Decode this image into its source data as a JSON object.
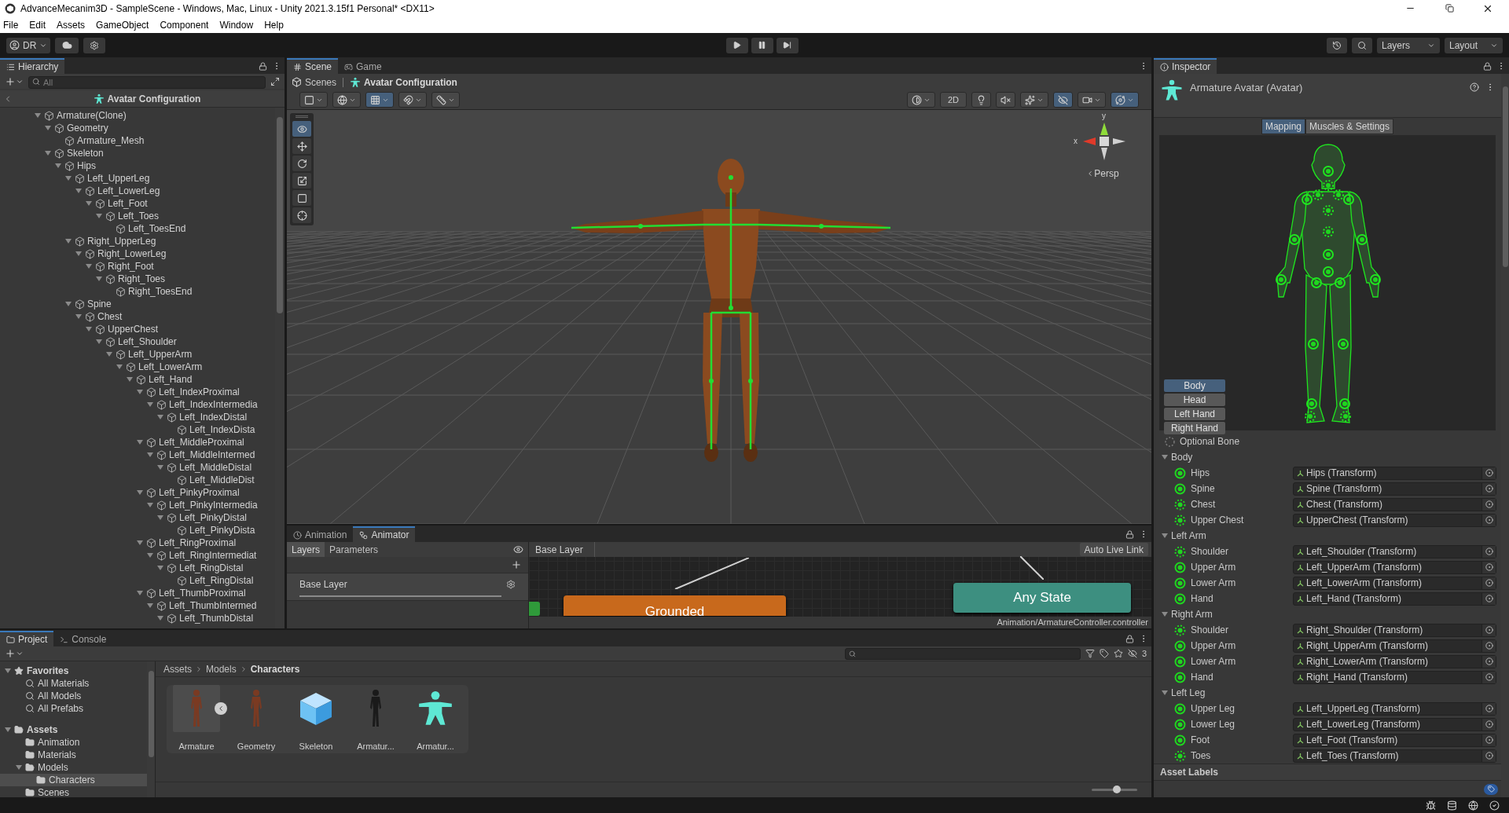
{
  "window": {
    "title": "AdvanceMecanim3D - SampleScene - Windows, Mac, Linux - Unity 2021.3.15f1 Personal* <DX11>"
  },
  "menu": [
    "File",
    "Edit",
    "Assets",
    "GameObject",
    "Component",
    "Window",
    "Help"
  ],
  "toolbar": {
    "account": "DR",
    "layers": "Layers",
    "layout": "Layout"
  },
  "hierarchy": {
    "tabs": [
      {
        "label": "Hierarchy",
        "kind": "hierarchy",
        "selected": true
      }
    ],
    "search": {
      "placeholder": "All"
    },
    "header": "Avatar Configuration",
    "tree": [
      {
        "label": "Armature(Clone)",
        "expanded": true,
        "children": [
          {
            "label": "Geometry",
            "expanded": true,
            "children": [
              {
                "label": "Armature_Mesh"
              }
            ]
          },
          {
            "label": "Skeleton",
            "expanded": true,
            "children": [
              {
                "label": "Hips",
                "expanded": true,
                "children": [
                  {
                    "label": "Left_UpperLeg",
                    "expanded": true,
                    "children": [
                      {
                        "label": "Left_LowerLeg",
                        "expanded": true,
                        "children": [
                          {
                            "label": "Left_Foot",
                            "expanded": true,
                            "children": [
                              {
                                "label": "Left_Toes",
                                "expanded": true,
                                "children": [
                                  {
                                    "label": "Left_ToesEnd"
                                  }
                                ]
                              }
                            ]
                          }
                        ]
                      }
                    ]
                  },
                  {
                    "label": "Right_UpperLeg",
                    "expanded": true,
                    "children": [
                      {
                        "label": "Right_LowerLeg",
                        "expanded": true,
                        "children": [
                          {
                            "label": "Right_Foot",
                            "expanded": true,
                            "children": [
                              {
                                "label": "Right_Toes",
                                "expanded": true,
                                "children": [
                                  {
                                    "label": "Right_ToesEnd"
                                  }
                                ]
                              }
                            ]
                          }
                        ]
                      }
                    ]
                  },
                  {
                    "label": "Spine",
                    "expanded": true,
                    "children": [
                      {
                        "label": "Chest",
                        "expanded": true,
                        "children": [
                          {
                            "label": "UpperChest",
                            "expanded": true,
                            "children": [
                              {
                                "label": "Left_Shoulder",
                                "expanded": true,
                                "children": [
                                  {
                                    "label": "Left_UpperArm",
                                    "expanded": true,
                                    "children": [
                                      {
                                        "label": "Left_LowerArm",
                                        "expanded": true,
                                        "children": [
                                          {
                                            "label": "Left_Hand",
                                            "expanded": true,
                                            "children": [
                                              {
                                                "label": "Left_IndexProximal",
                                                "expanded": true,
                                                "children": [
                                                  {
                                                    "label": "Left_IndexIntermedia",
                                                    "expanded": true,
                                                    "children": [
                                                      {
                                                        "label": "Left_IndexDistal",
                                                        "expanded": true,
                                                        "children": [
                                                          {
                                                            "label": "Left_IndexDista"
                                                          }
                                                        ]
                                                      }
                                                    ]
                                                  }
                                                ]
                                              },
                                              {
                                                "label": "Left_MiddleProximal",
                                                "expanded": true,
                                                "children": [
                                                  {
                                                    "label": "Left_MiddleIntermed",
                                                    "expanded": true,
                                                    "children": [
                                                      {
                                                        "label": "Left_MiddleDistal",
                                                        "expanded": true,
                                                        "children": [
                                                          {
                                                            "label": "Left_MiddleDist"
                                                          }
                                                        ]
                                                      }
                                                    ]
                                                  }
                                                ]
                                              },
                                              {
                                                "label": "Left_PinkyProximal",
                                                "expanded": true,
                                                "children": [
                                                  {
                                                    "label": "Left_PinkyIntermedia",
                                                    "expanded": true,
                                                    "children": [
                                                      {
                                                        "label": "Left_PinkyDistal",
                                                        "expanded": true,
                                                        "children": [
                                                          {
                                                            "label": "Left_PinkyDista"
                                                          }
                                                        ]
                                                      }
                                                    ]
                                                  }
                                                ]
                                              },
                                              {
                                                "label": "Left_RingProximal",
                                                "expanded": true,
                                                "children": [
                                                  {
                                                    "label": "Left_RingIntermediat",
                                                    "expanded": true,
                                                    "children": [
                                                      {
                                                        "label": "Left_RingDistal",
                                                        "expanded": true,
                                                        "children": [
                                                          {
                                                            "label": "Left_RingDistal"
                                                          }
                                                        ]
                                                      }
                                                    ]
                                                  }
                                                ]
                                              },
                                              {
                                                "label": "Left_ThumbProximal",
                                                "expanded": true,
                                                "children": [
                                                  {
                                                    "label": "Left_ThumbIntermed",
                                                    "expanded": true,
                                                    "children": [
                                                      {
                                                        "label": "Left_ThumbDistal",
                                                        "expanded": true
                                                      }
                                                    ]
                                                  }
                                                ]
                                              }
                                            ]
                                          }
                                        ]
                                      }
                                    ]
                                  }
                                ]
                              }
                            ]
                          }
                        ]
                      }
                    ]
                  }
                ]
              }
            ]
          }
        ]
      }
    ]
  },
  "scene": {
    "tabs": [
      {
        "label": "Scene",
        "kind": "scene",
        "selected": true
      },
      {
        "label": "Game",
        "kind": "game",
        "selected": false
      }
    ],
    "breadcrumb": [
      "Scenes",
      "Avatar Configuration"
    ],
    "toolbar_left": [
      {
        "kind": "draw-mode",
        "on": false,
        "dropdown": true
      },
      {
        "kind": "globe",
        "on": false,
        "dropdown": true
      },
      {
        "kind": "grid-snap",
        "on": true,
        "dropdown": true
      },
      {
        "kind": "snap-increment",
        "on": false,
        "dropdown": true
      },
      {
        "kind": "ruler",
        "on": false,
        "dropdown": true
      }
    ],
    "toolbar_right": [
      {
        "kind": "shading",
        "on": false,
        "dropdown": true
      },
      {
        "kind": "text",
        "label": "2D",
        "on": false,
        "dropdown": false
      },
      {
        "kind": "lighting",
        "on": false,
        "dropdown": false
      },
      {
        "kind": "audio",
        "on": false,
        "dropdown": false
      },
      {
        "kind": "effects",
        "on": false,
        "dropdown": true
      },
      {
        "kind": "hidden",
        "on": true,
        "dropdown": false
      },
      {
        "kind": "camera",
        "on": false,
        "dropdown": true
      },
      {
        "kind": "gizmos",
        "on": true,
        "dropdown": true
      }
    ],
    "tools": [
      {
        "kind": "view",
        "selected": true
      },
      {
        "kind": "move",
        "selected": false
      },
      {
        "kind": "rotate",
        "selected": false
      },
      {
        "kind": "scale",
        "selected": false
      },
      {
        "kind": "rect",
        "selected": false
      },
      {
        "kind": "transform",
        "selected": false
      }
    ],
    "gizmo_labels": [
      "y",
      "x"
    ],
    "view_label": "Persp"
  },
  "animator": {
    "tabs": [
      {
        "label": "Animation",
        "kind": "animation",
        "selected": false
      },
      {
        "label": "Animator",
        "kind": "animator",
        "selected": true
      }
    ],
    "side_tabs": [
      {
        "label": "Layers",
        "selected": true
      },
      {
        "label": "Parameters",
        "selected": false
      }
    ],
    "layers": [
      "Base Layer"
    ],
    "breadcrumb": "Base Layer",
    "live_link": "Auto Live Link",
    "states": [
      {
        "label": "Grounded",
        "color": "#c8691c"
      },
      {
        "label": "Any State",
        "color": "#3d8f80"
      }
    ],
    "path": "Animation/ArmatureController.controller"
  },
  "project": {
    "tabs": [
      {
        "label": "Project",
        "kind": "project",
        "selected": true
      },
      {
        "label": "Console",
        "kind": "console",
        "selected": false
      }
    ],
    "tree": [
      {
        "label": "Favorites",
        "kind": "favorites",
        "expanded": true,
        "selected": false,
        "children": [
          {
            "label": "All Materials",
            "kind": "search",
            "selected": false
          },
          {
            "label": "All Models",
            "kind": "search",
            "selected": false
          },
          {
            "label": "All Prefabs",
            "kind": "search",
            "selected": false
          }
        ]
      },
      {
        "label": "Assets",
        "kind": "folder",
        "expanded": true,
        "selected": false,
        "children": [
          {
            "label": "Animation",
            "kind": "folder",
            "selected": false
          },
          {
            "label": "Materials",
            "kind": "folder",
            "selected": false
          },
          {
            "label": "Models",
            "kind": "folder",
            "expanded": true,
            "selected": false,
            "children": [
              {
                "label": "Characters",
                "kind": "folder",
                "selected": true
              }
            ]
          },
          {
            "label": "Scenes",
            "kind": "folder",
            "selected": false
          }
        ]
      }
    ],
    "breadcrumb": [
      "Assets",
      "Models",
      "Characters"
    ],
    "hidden_count": "3",
    "assets": [
      {
        "label": "Armature",
        "kind": "model"
      },
      {
        "label": "Geometry",
        "kind": "mesh"
      },
      {
        "label": "Skeleton",
        "kind": "prefab"
      },
      {
        "label": "Armatur...",
        "kind": "rig"
      },
      {
        "label": "Armatur...",
        "kind": "avatar"
      }
    ],
    "zoom": {
      "level": 0.55
    }
  },
  "inspector": {
    "tabs": [
      {
        "label": "Inspector",
        "kind": "inspector",
        "selected": true
      }
    ],
    "object": "Armature Avatar (Avatar)",
    "mode_tabs": [
      {
        "label": "Mapping",
        "selected": true
      },
      {
        "label": "Muscles & Settings",
        "selected": false
      }
    ],
    "views": [
      {
        "label": "Body",
        "selected": true
      },
      {
        "label": "Head",
        "selected": false
      },
      {
        "label": "Left Hand",
        "selected": false
      },
      {
        "label": "Right Hand",
        "selected": false
      }
    ],
    "legend": "Optional Bone",
    "groups": [
      {
        "label": "Body",
        "expanded": true,
        "bones": [
          {
            "label": "Hips",
            "value": "Hips (Transform)",
            "optional": false
          },
          {
            "label": "Spine",
            "value": "Spine (Transform)",
            "optional": false
          },
          {
            "label": "Chest",
            "value": "Chest (Transform)",
            "optional": true
          },
          {
            "label": "Upper Chest",
            "value": "UpperChest (Transform)",
            "optional": true
          }
        ]
      },
      {
        "label": "Left Arm",
        "expanded": true,
        "bones": [
          {
            "label": "Shoulder",
            "value": "Left_Shoulder (Transform)",
            "optional": true
          },
          {
            "label": "Upper Arm",
            "value": "Left_UpperArm (Transform)",
            "optional": false
          },
          {
            "label": "Lower Arm",
            "value": "Left_LowerArm (Transform)",
            "optional": false
          },
          {
            "label": "Hand",
            "value": "Left_Hand (Transform)",
            "optional": false
          }
        ]
      },
      {
        "label": "Right Arm",
        "expanded": true,
        "bones": [
          {
            "label": "Shoulder",
            "value": "Right_Shoulder (Transform)",
            "optional": true
          },
          {
            "label": "Upper Arm",
            "value": "Right_UpperArm (Transform)",
            "optional": false
          },
          {
            "label": "Lower Arm",
            "value": "Right_LowerArm (Transform)",
            "optional": false
          },
          {
            "label": "Hand",
            "value": "Right_Hand (Transform)",
            "optional": false
          }
        ]
      },
      {
        "label": "Left Leg",
        "expanded": true,
        "bones": [
          {
            "label": "Upper Leg",
            "value": "Left_UpperLeg (Transform)",
            "optional": false
          },
          {
            "label": "Lower Leg",
            "value": "Left_LowerLeg (Transform)",
            "optional": false
          },
          {
            "label": "Foot",
            "value": "Left_Foot (Transform)",
            "optional": false
          },
          {
            "label": "Toes",
            "value": "Left_Toes (Transform)",
            "optional": true
          }
        ]
      }
    ],
    "asset_labels": "Asset Labels"
  }
}
